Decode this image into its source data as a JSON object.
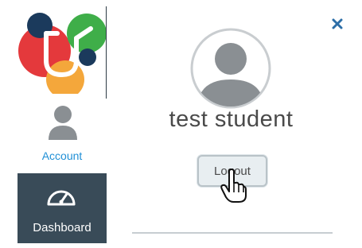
{
  "global_nav": {
    "items": [
      {
        "label": "Account",
        "icon": "account-avatar-icon",
        "active": true
      },
      {
        "label": "Dashboard",
        "icon": "dashboard-gauge-icon",
        "active": false
      }
    ]
  },
  "profile_tray": {
    "user_name": "test student",
    "logout_label": "Logout",
    "close_icon": "close-icon"
  },
  "colors": {
    "nav_dark": "#394b58",
    "account_label": "#1f8fd6",
    "logo_red": "#e4393c",
    "logo_green": "#3fae49",
    "logo_orange": "#f4a73b",
    "logo_navy": "#1b3a5c",
    "close_icon": "#2c6ea7"
  }
}
